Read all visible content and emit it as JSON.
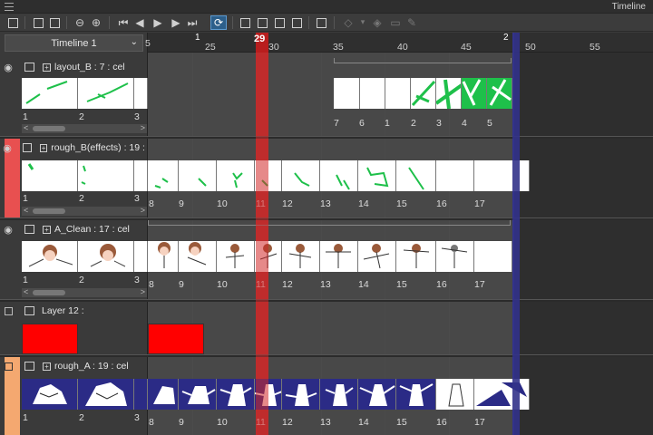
{
  "titlebar": {
    "title": "Timeline"
  },
  "toolbar": {
    "icons": [
      "new-timeline-icon",
      "timeline-settings-icon",
      "zoom-out-icon",
      "zoom-in-icon",
      "first-frame-icon",
      "prev-frame-icon",
      "play-icon",
      "next-frame-icon",
      "last-frame-icon",
      "loop-icon",
      "new-cel-icon",
      "specify-cel-icon",
      "camera-work-icon",
      "layer-folder-icon",
      "onion-skin-icon",
      "new-animation-folder-icon",
      "light-table-icon",
      "pen-icon"
    ]
  },
  "timeline_selector": {
    "value": "Timeline 1"
  },
  "ruler": {
    "start_label": "1",
    "current_frame": "29",
    "end_label": "2",
    "ticks": [
      "25",
      "30",
      "35",
      "40",
      "45",
      "50",
      "55"
    ],
    "leading": "5"
  },
  "layers": [
    {
      "name": "layout_B : 7 : cel",
      "color": "",
      "visible": true,
      "left_cels": [
        "1",
        "2",
        "3"
      ],
      "track_numbers": [
        "7",
        "6",
        "1",
        "2",
        "3",
        "4",
        "5"
      ]
    },
    {
      "name": "rough_B(effects) : 19 : cel",
      "color": "#e85050",
      "visible": true,
      "left_cels": [
        "1",
        "2",
        "3"
      ],
      "track_numbers": [
        "8",
        "9",
        "10",
        "11",
        "12",
        "13",
        "14",
        "15",
        "16",
        "17"
      ]
    },
    {
      "name": "A_Clean : 17 : cel",
      "color": "",
      "visible": true,
      "left_cels": [
        "1",
        "2",
        "3"
      ],
      "track_numbers": [
        "8",
        "9",
        "10",
        "11",
        "12",
        "13",
        "14",
        "15",
        "16",
        "17"
      ]
    },
    {
      "name": "Layer 12 :",
      "color": "",
      "visible": false,
      "left_cels": [],
      "track_numbers": []
    },
    {
      "name": "rough_A : 19 : cel",
      "color": "#f4a870",
      "visible": false,
      "left_cels": [
        "1",
        "2",
        "3"
      ],
      "track_numbers": [
        "8",
        "9",
        "10",
        "11",
        "12",
        "13",
        "14",
        "15",
        "16",
        "17"
      ]
    }
  ],
  "colors": {
    "playhead": "#d22828",
    "accent": "#2d5f8a",
    "end_marker": "#3d3d9a",
    "cel_blue": "#2b2b86",
    "red_cel": "#ff0000"
  }
}
